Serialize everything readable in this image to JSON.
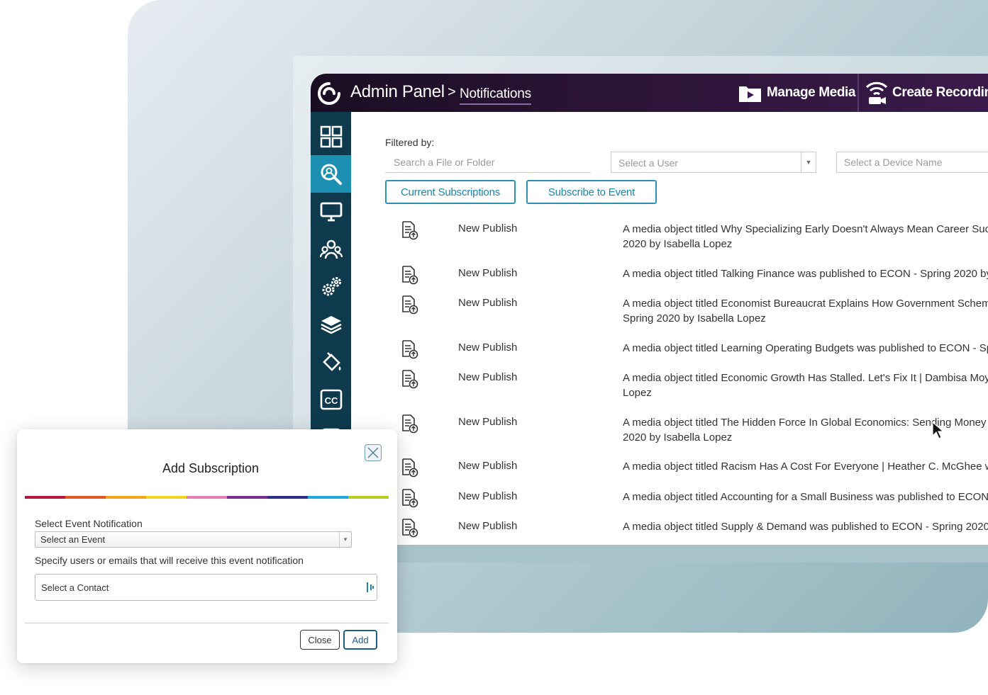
{
  "header": {
    "title": "Admin Panel",
    "separator": ">",
    "subtitle": "Notifications",
    "manage_media_label": "Manage Media",
    "create_recording_label": "Create Recordin"
  },
  "sidebar": {
    "items": [
      {
        "icon": "dashboard-grid-icon",
        "active": false
      },
      {
        "icon": "search-icon",
        "active": true
      },
      {
        "icon": "monitor-icon",
        "active": false
      },
      {
        "icon": "users-group-icon",
        "active": false
      },
      {
        "icon": "gears-icon",
        "active": false
      },
      {
        "icon": "layers-icon",
        "active": false
      },
      {
        "icon": "paint-bucket-icon",
        "active": false
      },
      {
        "icon": "closed-captions-icon",
        "active": false
      }
    ],
    "cc_text": "CC"
  },
  "filters": {
    "label": "Filtered by:",
    "search_placeholder": "Search a File or Folder",
    "user_select": "Select a User",
    "device_placeholder": "Select a Device Name"
  },
  "tabs": {
    "current": "Current Subscriptions",
    "subscribe": "Subscribe to Event"
  },
  "notifications": [
    {
      "event": "New Publish",
      "description": "A media object titled Why Specializing Early Doesn't Always Mean Career Succ\n2020 by Isabella Lopez"
    },
    {
      "event": "New Publish",
      "description": "A media object titled Talking Finance was published to ECON - Spring 2020 by"
    },
    {
      "event": "New Publish",
      "description": "A media object titled Economist Bureaucrat Explains How Government Schem\nSpring 2020 by Isabella Lopez"
    },
    {
      "event": "New Publish",
      "description": "A media object titled Learning Operating Budgets was published to ECON - Sp"
    },
    {
      "event": "New Publish",
      "description": "A media object titled Economic Growth Has Stalled. Let's Fix It | Dambisa Moyo\nLopez"
    },
    {
      "event": "New Publish",
      "description": "A media object titled The Hidden Force In Global Economics: Sending Money\n2020 by Isabella Lopez"
    },
    {
      "event": "New Publish",
      "description": "A media object titled Racism Has A Cost For Everyone | Heather C. McGhee w"
    },
    {
      "event": "New Publish",
      "description": "A media object titled Accounting for a Small Business was published to ECON"
    },
    {
      "event": "New Publish",
      "description": "A media object titled Supply & Demand was published to ECON - Spring 2020"
    }
  ],
  "dialog": {
    "title": "Add Subscription",
    "rainbow_colors": [
      "#b5163d",
      "#e2581f",
      "#f5a31a",
      "#f2d51d",
      "#e77fb7",
      "#7a2c8c",
      "#2d2e86",
      "#1ea8df",
      "#b6cf1d"
    ],
    "event_label": "Select Event Notification",
    "event_select": "Select an Event",
    "recipients_label": "Specify users or emails that will receive this event notification",
    "contact_select": "Select a Contact",
    "close_label": "Close",
    "add_label": "Add"
  },
  "colors": {
    "accent": "#1d86ad",
    "sidebar": "#0f3a4e",
    "sidebar_active": "#1d8fb0",
    "header": "#2a1334"
  }
}
